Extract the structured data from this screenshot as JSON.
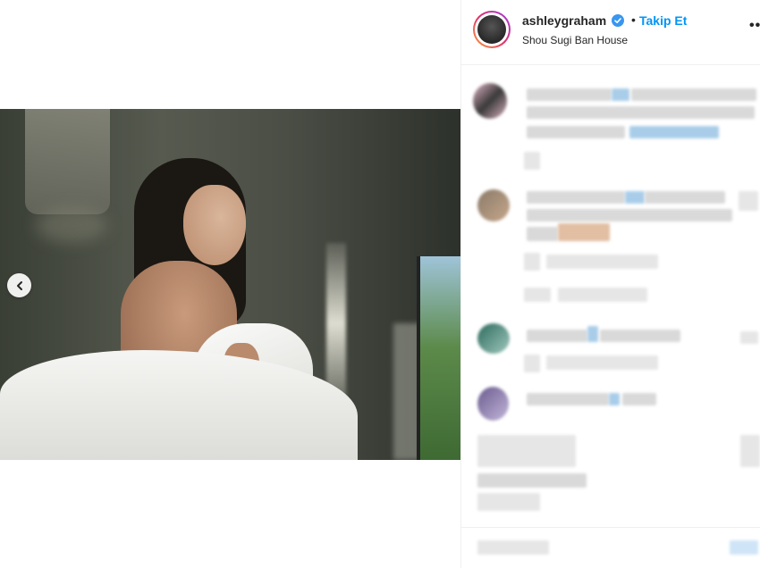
{
  "post": {
    "username": "ashleygraham",
    "separator": "•",
    "follow_label": "Takip Et",
    "location": "Shou Sugi Ban House",
    "more_label": "•••"
  },
  "colors": {
    "accent": "#0095f6",
    "text": "#262626",
    "divider": "#efefef"
  },
  "icons": {
    "verified": "verified-badge-icon",
    "prev": "chevron-left-icon"
  }
}
